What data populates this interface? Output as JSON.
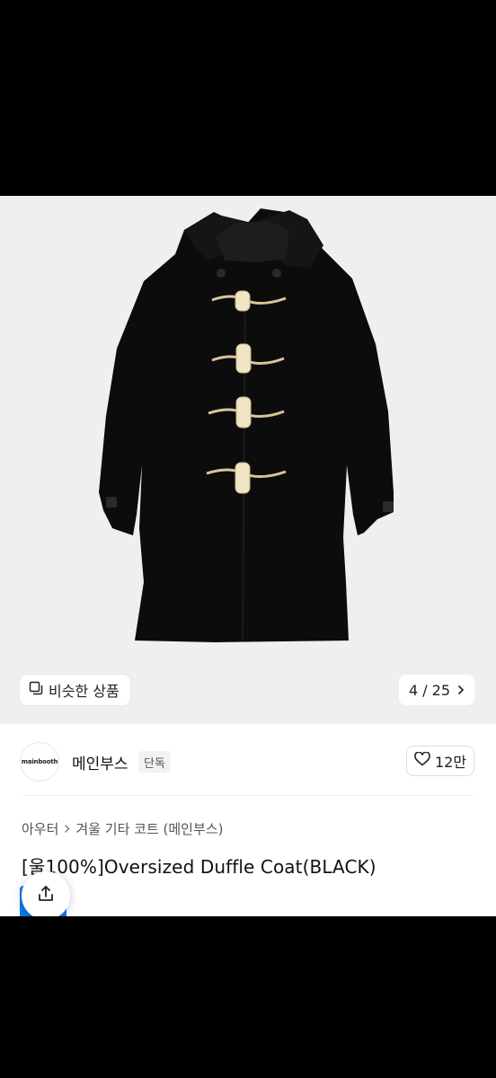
{
  "gallery": {
    "similar_label": "비슷한 상품",
    "counter_label": "4 / 25"
  },
  "brand": {
    "logo_text": "mainbooth",
    "name": "메인부스",
    "badge": "단독"
  },
  "like": {
    "count_label": "12만"
  },
  "breadcrumb": {
    "items": [
      "아우터",
      "겨울 기타 코트 (메인부스)"
    ]
  },
  "product": {
    "title": "[울100%]Oversized Duffle Coat(BLACK)"
  },
  "icons": {
    "similar": "similar-items-icon",
    "next": "chevron-right-icon",
    "heart": "heart-icon",
    "share": "share-icon",
    "breadcrumb_separator": "chevron-right-icon"
  },
  "colors": {
    "accent_blue": "#0a7cf0",
    "image_bg": "#efefef"
  }
}
